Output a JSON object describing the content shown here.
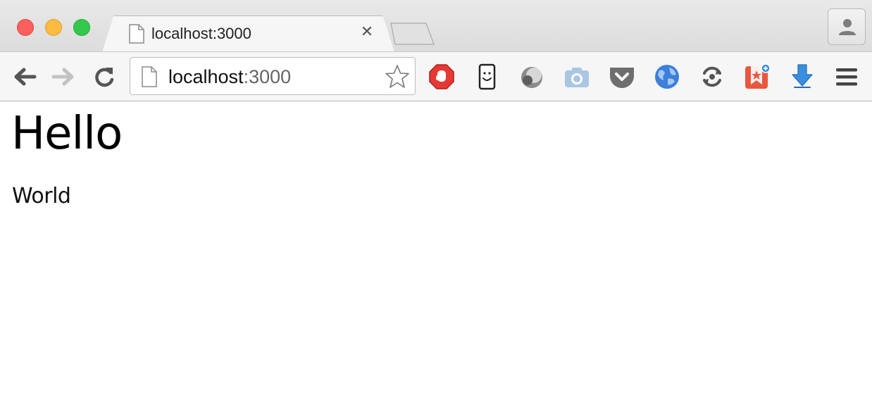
{
  "window": {
    "controls": [
      "close",
      "minimize",
      "maximize"
    ]
  },
  "tab": {
    "title": "localhost:3000",
    "close_glyph": "✕",
    "icon": "page-icon"
  },
  "toolbar": {
    "back_icon": "arrow-left-icon",
    "forward_icon": "arrow-right-icon",
    "reload_icon": "reload-icon",
    "address": {
      "host": "localhost",
      "port": ":3000"
    },
    "bookmark_icon": "star-icon",
    "extensions": [
      "adblock-icon",
      "face-icon",
      "moon-icon",
      "camera-icon",
      "pocket-icon",
      "globe-icon",
      "sync-icon",
      "wunderlist-icon",
      "download-icon"
    ],
    "menu_icon": "hamburger-menu-icon"
  },
  "colors": {
    "close": "#fc605c",
    "minimize": "#fdbc40",
    "maximize": "#34c84a",
    "adblock": "#e53935",
    "pocket": "#6e6e6e",
    "globe": "#3d7fd9",
    "wunderlist": "#e8573f",
    "download": "#3b8fe0"
  },
  "page": {
    "heading": "Hello",
    "paragraph": "World"
  }
}
